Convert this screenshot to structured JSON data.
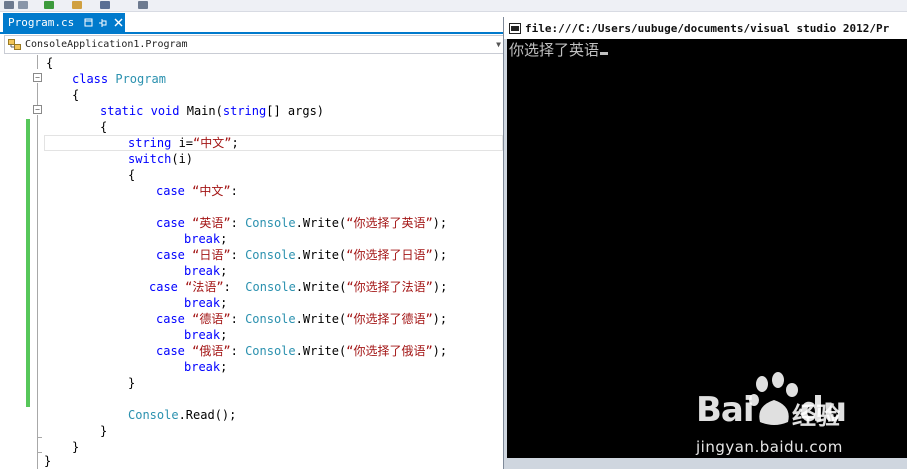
{
  "tab": {
    "filename": "Program.cs",
    "pin_icon": "pin-icon",
    "close_icon": "close-icon"
  },
  "navigation": {
    "class_selector": "ConsoleApplication1.Program"
  },
  "code": {
    "brace": "{",
    "close_brace": "}",
    "kw_class": "class",
    "class_name": "Program",
    "kw_static": "static",
    "kw_void": "void",
    "method_name": "Main",
    "kw_string": "string",
    "main_params": "[] args)",
    "paren_open": "(",
    "var_decl": " i=",
    "var_value": "“中文”",
    "semicolon": ";",
    "kw_switch": "switch",
    "switch_arg": "(i)",
    "kw_case": "case",
    "kw_break": "break",
    "colon": ":",
    "console_type": "Console",
    "write_method": ".Write(",
    "write_close": ");",
    "read_call": ".Read();",
    "cases": [
      {
        "label": "“中文”",
        "output": ""
      },
      {
        "label": "“英语”",
        "output": "“你选择了英语”"
      },
      {
        "label": "“日语”",
        "output": "“你选择了日语”"
      },
      {
        "label": "“法语”",
        "output": "“你选择了法语”"
      },
      {
        "label": "“德语”",
        "output": "“你选择了德语”"
      },
      {
        "label": "“俄语”",
        "output": "“你选择了俄语”"
      }
    ]
  },
  "console": {
    "title": "file:///C:/Users/uubuge/documents/visual studio 2012/Pr",
    "output": "你选择了英语"
  },
  "watermark": {
    "logo": "Bai",
    "logo_tail": "du",
    "subtitle": "经验",
    "url": "jingyan.baidu.com"
  },
  "colors": {
    "accent": "#007acc",
    "keyword": "#0000ff",
    "type": "#2b91af",
    "string": "#a31515",
    "changed_line_marker": "#57c75a",
    "console_background": "#000000"
  }
}
